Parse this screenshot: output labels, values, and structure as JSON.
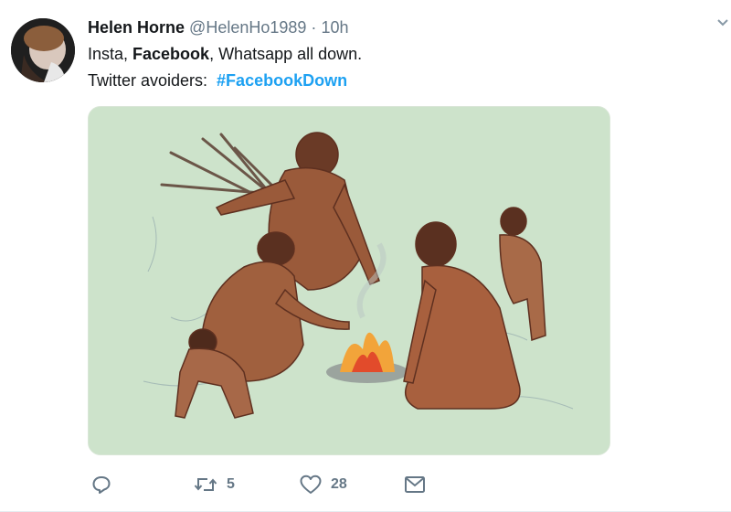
{
  "tweet": {
    "author_name": "Helen Horne",
    "handle": "@HelenHo1989",
    "separator": "·",
    "time": "10h",
    "text_line1": {
      "part1": "Insta, ",
      "bold": "Facebook",
      "part2": ", Whatsapp all down."
    },
    "text_line2": {
      "prefix": "Twitter avoiders:",
      "hashtag": "#FacebookDown"
    }
  },
  "actions": {
    "reply_icon": "reply-icon",
    "retweet_icon": "retweet-icon",
    "retweet_count": "5",
    "like_icon": "heart-icon",
    "like_count": "28",
    "dm_icon": "envelope-icon"
  },
  "colors": {
    "link": "#1da1f2",
    "muted": "#657786",
    "image_bg": "#cde3cb"
  }
}
